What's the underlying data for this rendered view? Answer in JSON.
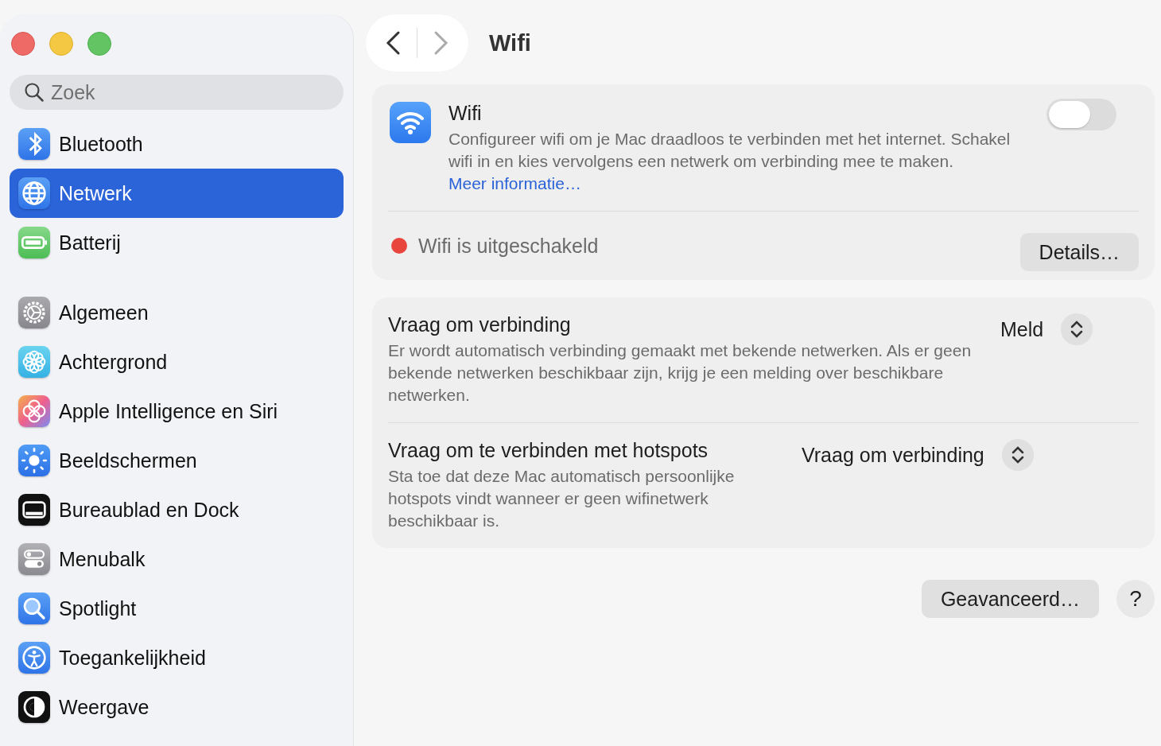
{
  "window": {
    "title": "Wifi"
  },
  "sidebar": {
    "search": {
      "placeholder": "Zoek"
    },
    "groups": [
      {
        "items": [
          {
            "label": "Bluetooth",
            "kind": "bluetooth",
            "selected": false
          },
          {
            "label": "Netwerk",
            "kind": "network",
            "selected": true
          },
          {
            "label": "Batterij",
            "kind": "battery",
            "selected": false
          }
        ]
      },
      {
        "items": [
          {
            "label": "Algemeen",
            "kind": "general",
            "selected": false
          },
          {
            "label": "Achtergrond",
            "kind": "wallpaper",
            "selected": false
          },
          {
            "label": "Apple Intelligence en Siri",
            "kind": "siri",
            "selected": false
          },
          {
            "label": "Beeldschermen",
            "kind": "displays",
            "selected": false
          },
          {
            "label": "Bureaublad en Dock",
            "kind": "dock",
            "selected": false
          },
          {
            "label": "Menubalk",
            "kind": "menubar",
            "selected": false
          },
          {
            "label": "Spotlight",
            "kind": "spotlight",
            "selected": false
          },
          {
            "label": "Toegankelijkheid",
            "kind": "accessibility",
            "selected": false
          },
          {
            "label": "Weergave",
            "kind": "appearance",
            "selected": false
          }
        ]
      }
    ]
  },
  "wifi_card": {
    "title": "Wifi",
    "description": "Configureer wifi om je Mac draadloos te verbinden met het internet. Schakel wifi in en kies vervolgens een netwerk om verbinding mee te maken.",
    "link": "Meer informatie…",
    "on": false,
    "status": {
      "text": "Wifi is uitgeschakeld",
      "color": "#e8453c"
    },
    "details_button": "Details…"
  },
  "options": [
    {
      "title": "Vraag om verbinding",
      "description": "Er wordt automatisch verbinding gemaakt met bekende netwerken. Als er geen bekende netwerken beschikbaar zijn, krijg je een melding over beschikbare netwerken.",
      "value": "Meld"
    },
    {
      "title": "Vraag om te verbinden met hotspots",
      "description": "Sta toe dat deze Mac automatisch persoonlijke hotspots vindt wanneer er geen wifinetwerk beschikbaar is.",
      "value": "Vraag om verbinding"
    }
  ],
  "footer": {
    "advanced_button": "Geavanceerd…",
    "help_button": "?"
  }
}
